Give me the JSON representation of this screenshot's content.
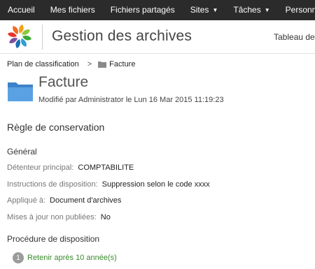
{
  "topnav": {
    "items": [
      {
        "label": "Accueil",
        "has_caret": false
      },
      {
        "label": "Mes fichiers",
        "has_caret": false
      },
      {
        "label": "Fichiers partagés",
        "has_caret": false
      },
      {
        "label": "Sites",
        "has_caret": true
      },
      {
        "label": "Tâches",
        "has_caret": true
      },
      {
        "label": "Personnes",
        "has_caret": false
      }
    ],
    "caret_glyph": "▼"
  },
  "header": {
    "site_title": "Gestion des archives",
    "dashboard_link": "Tableau de"
  },
  "breadcrumb": {
    "root": "Plan de classification",
    "separator": ">",
    "current": "Facture"
  },
  "item": {
    "title": "Facture",
    "modified": "Modifié par Administrator le Lun 16 Mar 2015 11:19:23"
  },
  "retention": {
    "heading": "Règle de conservation",
    "general_heading": "Général",
    "properties": [
      {
        "label": "Détenteur principal:",
        "value": "COMPTABILITE"
      },
      {
        "label": "Instructions de disposition:",
        "value": "Suppression selon le code xxxx"
      },
      {
        "label": "Appliqué à:",
        "value": "Document d'archives"
      },
      {
        "label": "Mises à jour non publiées:",
        "value": "No"
      }
    ],
    "procedure_heading": "Procédure de disposition",
    "steps": [
      {
        "number": "1",
        "label": "Retenir après 10 année(s)"
      }
    ]
  },
  "colors": {
    "nav_bg": "#2b2b2b",
    "link_green": "#3a8a2e",
    "folder_blue": "#4a90d9"
  }
}
